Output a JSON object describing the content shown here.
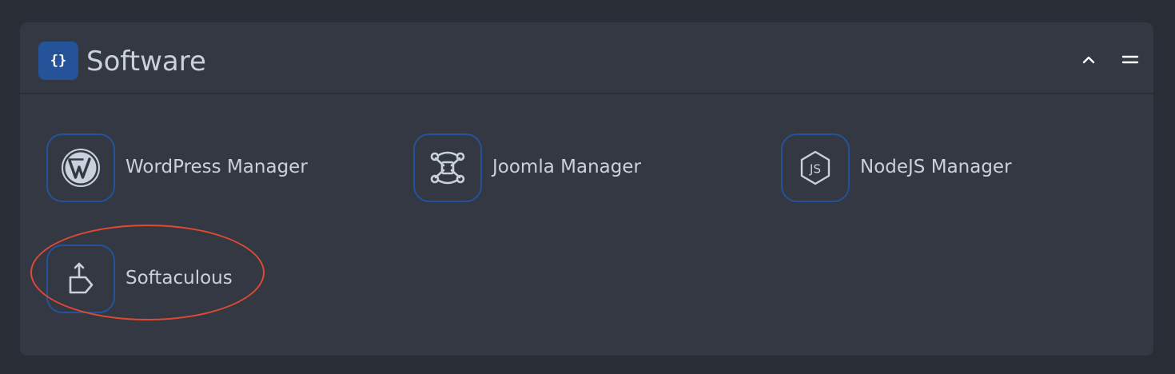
{
  "panel": {
    "title": "Software",
    "header_icon_glyph": "{}"
  },
  "items": [
    {
      "label": "WordPress Manager",
      "icon": "wordpress-icon"
    },
    {
      "label": "Joomla Manager",
      "icon": "joomla-icon"
    },
    {
      "label": "NodeJS Manager",
      "icon": "nodejs-icon"
    },
    {
      "label": "Softaculous",
      "icon": "softaculous-icon"
    }
  ],
  "colors": {
    "page_background": "#292d35",
    "panel_background": "#333843",
    "accent_blue": "#24539a",
    "text": "#c9d1dc",
    "highlight": "#e04a32"
  }
}
